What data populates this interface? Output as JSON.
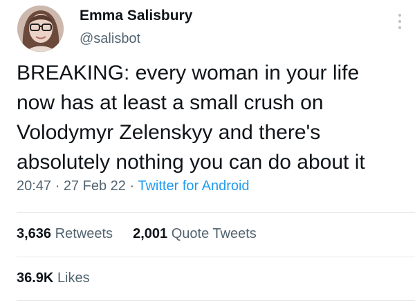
{
  "author": {
    "name": "Emma Salisbury",
    "handle": "@salisbot",
    "avatar_icon": "user-avatar-photo"
  },
  "tweet": {
    "text": "BREAKING: every woman in your life\nnow has at least a small crush on\nVolodymyr Zelenskyy and there's\nabsolutely nothing you can do about it"
  },
  "meta": {
    "time": "20:47",
    "date": "27 Feb 22",
    "separator": "·",
    "source": "Twitter for Android"
  },
  "stats": {
    "retweets_count": "3,636",
    "retweets_label": "Retweets",
    "quotes_count": "2,001",
    "quotes_label": "Quote Tweets",
    "likes_count": "36.9K",
    "likes_label": "Likes"
  },
  "colors": {
    "text": "#0f1419",
    "secondary": "#536471",
    "link": "#1d9bf0",
    "divider": "#e6e9eb"
  }
}
